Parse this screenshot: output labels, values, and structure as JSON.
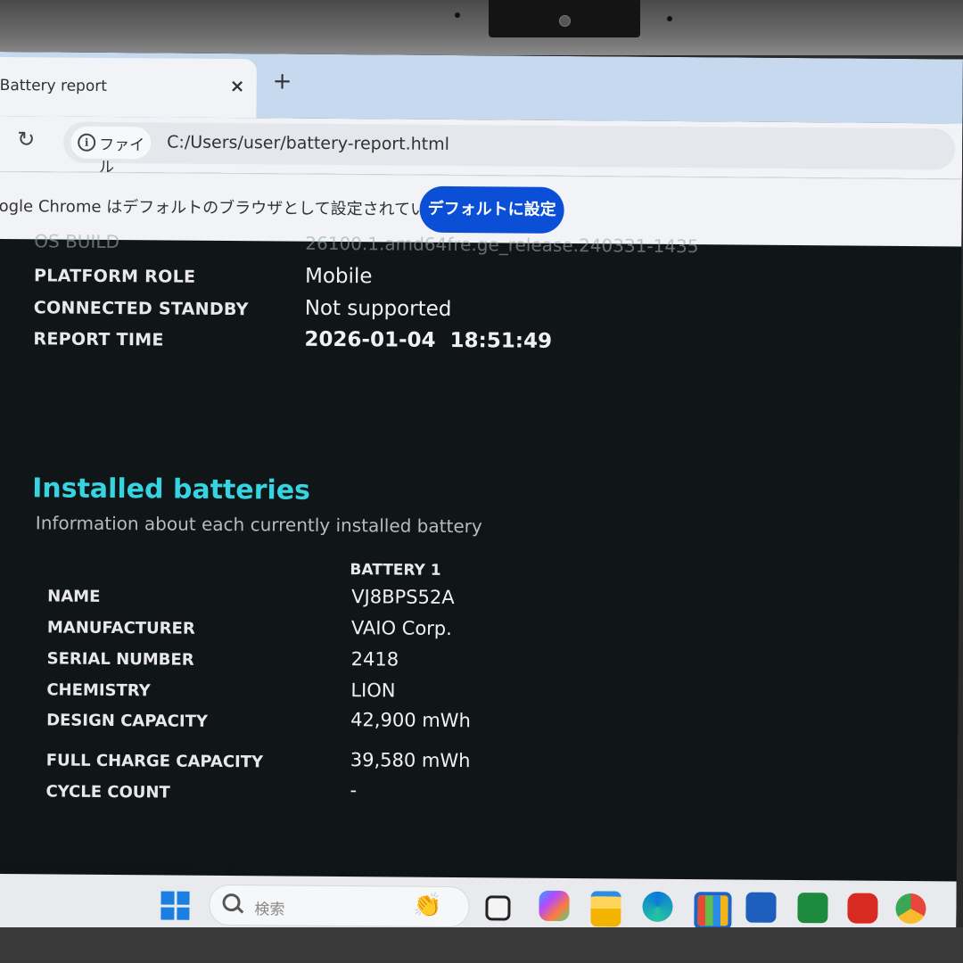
{
  "browser": {
    "tab_title": "Battery report",
    "tab_close": "×",
    "new_tab": "+",
    "site_label": "ファイル",
    "url": "C:/Users/user/battery-report.html",
    "infobar_text": "ogle Chrome はデフォルトのブラウザとして設定されていません",
    "default_button": "デフォルトに設定"
  },
  "system": {
    "partial_row": {
      "label": "OS BUILD",
      "value": "26100.1.amd64fre.ge_release.240331-1435"
    },
    "rows": [
      {
        "label": "PLATFORM ROLE",
        "value": "Mobile"
      },
      {
        "label": "CONNECTED STANDBY",
        "value": "Not supported"
      },
      {
        "label": "REPORT TIME",
        "value": "2026-01-04  18:51:49"
      }
    ]
  },
  "installed_batteries": {
    "title": "Installed batteries",
    "subtitle": "Information about each currently installed battery",
    "column_header": "BATTERY 1",
    "rows": [
      {
        "label": "NAME",
        "value": "VJ8BPS52A"
      },
      {
        "label": "MANUFACTURER",
        "value": "VAIO Corp."
      },
      {
        "label": "SERIAL NUMBER",
        "value": "2418"
      },
      {
        "label": "CHEMISTRY",
        "value": "LION"
      },
      {
        "label": "DESIGN CAPACITY",
        "value": "42,900 mWh"
      },
      {
        "label": "FULL CHARGE CAPACITY",
        "value": "39,580 mWh"
      },
      {
        "label": "CYCLE COUNT",
        "value": "-"
      }
    ]
  },
  "taskbar": {
    "search_placeholder": "検索",
    "apps": [
      "task-view-icon",
      "copilot-icon",
      "file-explorer-icon",
      "edge-icon",
      "store-icon",
      "word-icon",
      "excel-icon",
      "acrobat-icon",
      "chrome-icon"
    ]
  },
  "colors": {
    "accent_heading": "#35d4e0",
    "default_button": "#0b4fd6",
    "report_background": "#101618"
  }
}
